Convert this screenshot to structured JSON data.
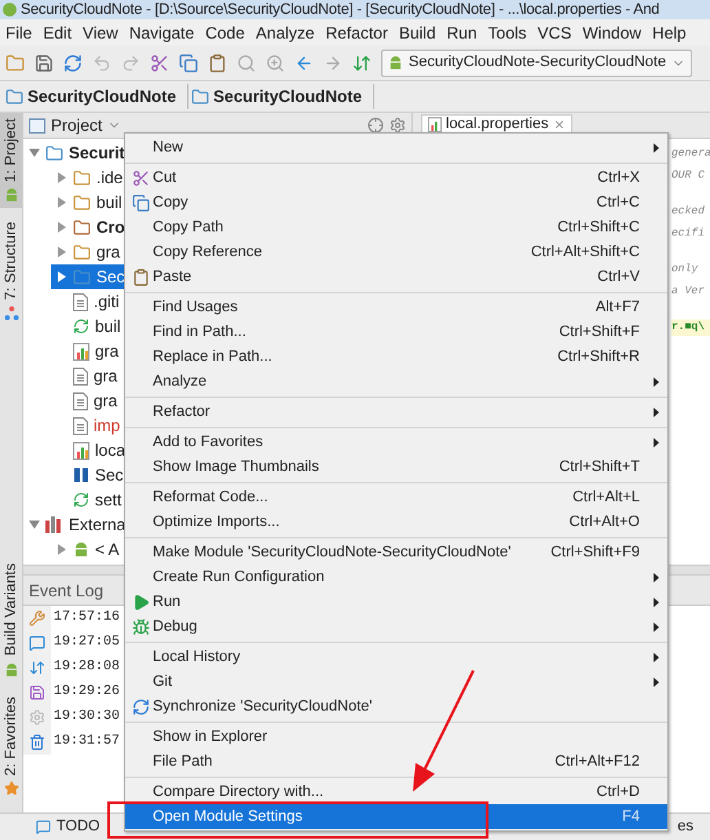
{
  "window": {
    "title": "SecurityCloudNote - [D:\\Source\\SecurityCloudNote] - [SecurityCloudNote] - ...\\local.properties - And"
  },
  "menu_bar": [
    "File",
    "Edit",
    "View",
    "Navigate",
    "Code",
    "Analyze",
    "Refactor",
    "Build",
    "Run",
    "Tools",
    "VCS",
    "Window",
    "Help"
  ],
  "toolbar": {
    "run_configuration": "SecurityCloudNote-SecurityCloudNote"
  },
  "breadcrumbs": [
    "SecurityCloudNote",
    "SecurityCloudNote"
  ],
  "tool_strip": {
    "top": [
      {
        "label": "1: Project",
        "kind": "project",
        "selected": true
      },
      {
        "label": "7: Structure",
        "kind": "structure",
        "selected": false
      }
    ],
    "bottom": [
      {
        "label": "Build Variants",
        "kind": "build",
        "selected": false
      },
      {
        "label": "2: Favorites",
        "kind": "favorites",
        "selected": false
      }
    ]
  },
  "project_panel": {
    "title": "Project",
    "tree": [
      {
        "label": "Securit",
        "kind": "module",
        "bold": true,
        "expanded": true,
        "selected": false,
        "children": [
          {
            "label": ".ide",
            "kind": "folder",
            "expanded": false,
            "selected": false
          },
          {
            "label": "buil",
            "kind": "folder",
            "expanded": false,
            "selected": false
          },
          {
            "label": "Cro",
            "kind": "gradle-module",
            "bold": true,
            "expanded": false,
            "selected": false
          },
          {
            "label": "gra",
            "kind": "folder",
            "expanded": false,
            "selected": false
          },
          {
            "label": "Sec",
            "kind": "module",
            "expanded": false,
            "selected": true
          },
          {
            "label": ".giti",
            "kind": "file",
            "selected": false
          },
          {
            "label": "buil",
            "kind": "gradle",
            "selected": false
          },
          {
            "label": "gra",
            "kind": "properties",
            "selected": false
          },
          {
            "label": "gra",
            "kind": "file",
            "selected": false
          },
          {
            "label": "gra",
            "kind": "file",
            "selected": false
          },
          {
            "label": "imp",
            "kind": "file",
            "color": "#d0392b",
            "selected": false
          },
          {
            "label": "loca",
            "kind": "properties",
            "selected": false
          },
          {
            "label": "Sec",
            "kind": "iml",
            "selected": false
          },
          {
            "label": "sett",
            "kind": "gradle",
            "selected": false
          }
        ]
      },
      {
        "label": "Externa",
        "kind": "library",
        "expanded": true,
        "selected": false,
        "children": [
          {
            "label": "< A",
            "kind": "android",
            "expanded": false,
            "selected": false
          }
        ]
      }
    ]
  },
  "editor": {
    "tab": "local.properties",
    "paragraphs": [
      {
        "kind": "comment",
        "lines": [
          "genera",
          "OUR C"
        ]
      },
      {
        "kind": "comment",
        "lines": [
          "ecked",
          "ecifi"
        ]
      },
      {
        "kind": "comment",
        "lines": [
          "only",
          "a Ver"
        ]
      },
      {
        "kind": "value",
        "lines": [
          "r.■q\\"
        ]
      }
    ]
  },
  "event_log": {
    "title": "Event Log",
    "times": [
      "17:57:16",
      "19:27:05",
      "19:28:08",
      "19:29:26",
      "19:30:30",
      "19:31:57"
    ]
  },
  "bottom_bar": {
    "tabs": [
      "TODO"
    ],
    "right_text": "es"
  },
  "context_menu": {
    "groups": [
      [
        {
          "label": "New",
          "kind": "plain",
          "submenu": true,
          "selected": false
        }
      ],
      [
        {
          "label": "Cut",
          "kind": "cut",
          "shortcut": "Ctrl+X",
          "submenu": false,
          "selected": false
        },
        {
          "label": "Copy",
          "kind": "copy",
          "shortcut": "Ctrl+C",
          "submenu": false,
          "selected": false
        },
        {
          "label": "Copy Path",
          "kind": "plain",
          "shortcut": "Ctrl+Shift+C",
          "submenu": false,
          "selected": false
        },
        {
          "label": "Copy Reference",
          "kind": "plain",
          "shortcut": "Ctrl+Alt+Shift+C",
          "submenu": false,
          "selected": false
        },
        {
          "label": "Paste",
          "kind": "paste",
          "shortcut": "Ctrl+V",
          "submenu": false,
          "selected": false
        }
      ],
      [
        {
          "label": "Find Usages",
          "kind": "plain",
          "shortcut": "Alt+F7",
          "submenu": false,
          "selected": false
        },
        {
          "label": "Find in Path...",
          "kind": "plain",
          "shortcut": "Ctrl+Shift+F",
          "submenu": false,
          "selected": false
        },
        {
          "label": "Replace in Path...",
          "kind": "plain",
          "shortcut": "Ctrl+Shift+R",
          "submenu": false,
          "selected": false
        },
        {
          "label": "Analyze",
          "kind": "plain",
          "submenu": true,
          "selected": false
        }
      ],
      [
        {
          "label": "Refactor",
          "kind": "plain",
          "submenu": true,
          "selected": false
        }
      ],
      [
        {
          "label": "Add to Favorites",
          "kind": "plain",
          "submenu": true,
          "selected": false
        },
        {
          "label": "Show Image Thumbnails",
          "kind": "plain",
          "shortcut": "Ctrl+Shift+T",
          "submenu": false,
          "selected": false
        }
      ],
      [
        {
          "label": "Reformat Code...",
          "kind": "plain",
          "shortcut": "Ctrl+Alt+L",
          "submenu": false,
          "selected": false
        },
        {
          "label": "Optimize Imports...",
          "kind": "plain",
          "shortcut": "Ctrl+Alt+O",
          "submenu": false,
          "selected": false
        }
      ],
      [
        {
          "label": "Make Module 'SecurityCloudNote-SecurityCloudNote'",
          "kind": "plain",
          "shortcut": "Ctrl+Shift+F9",
          "submenu": false,
          "selected": false
        },
        {
          "label": "Create Run Configuration",
          "kind": "plain",
          "submenu": true,
          "selected": false
        },
        {
          "label": "Run",
          "kind": "run",
          "submenu": true,
          "selected": false
        },
        {
          "label": "Debug",
          "kind": "debug",
          "submenu": true,
          "selected": false
        }
      ],
      [
        {
          "label": "Local History",
          "kind": "plain",
          "submenu": true,
          "selected": false
        },
        {
          "label": "Git",
          "kind": "plain",
          "submenu": true,
          "selected": false
        },
        {
          "label": "Synchronize 'SecurityCloudNote'",
          "kind": "sync",
          "submenu": false,
          "selected": false
        }
      ],
      [
        {
          "label": "Show in Explorer",
          "kind": "plain",
          "submenu": false,
          "selected": false
        },
        {
          "label": "File Path",
          "kind": "plain",
          "shortcut": "Ctrl+Alt+F12",
          "submenu": false,
          "selected": false
        }
      ],
      [
        {
          "label": "Compare Directory with...",
          "kind": "plain",
          "shortcut": "Ctrl+D",
          "submenu": false,
          "selected": false
        },
        {
          "label": "Open Module Settings",
          "kind": "plain",
          "shortcut": "F4",
          "submenu": false,
          "selected": true
        }
      ]
    ]
  }
}
